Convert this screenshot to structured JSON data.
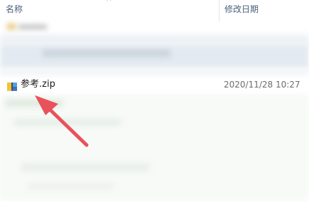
{
  "header": {
    "name_label": "名称",
    "date_label": "修改日期",
    "sort_indicator": "^"
  },
  "file": {
    "name": "参考.zip",
    "modified": "2020/11/28 10:27",
    "icon": "zip-archive-icon"
  },
  "colors": {
    "arrow": "#e8525a",
    "header_text": "#4c607a"
  }
}
